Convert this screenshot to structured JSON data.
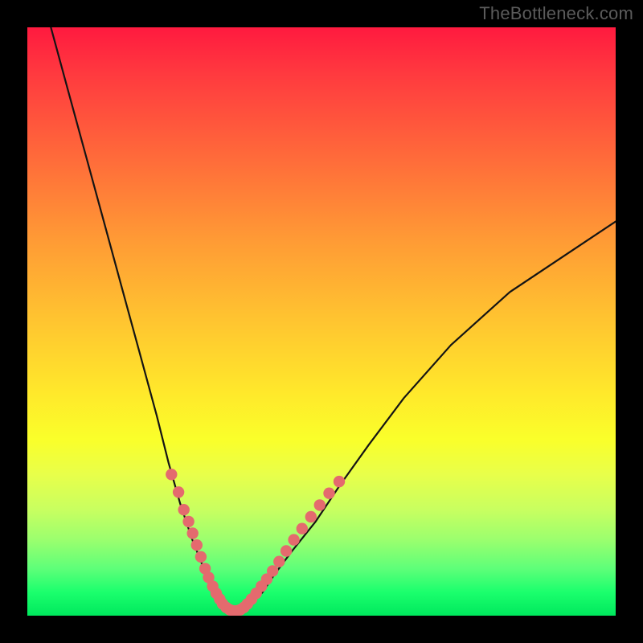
{
  "branding": {
    "watermark": "TheBottleneck.com"
  },
  "chart_data": {
    "type": "line",
    "title": "",
    "xlabel": "",
    "ylabel": "",
    "xlim": [
      0,
      100
    ],
    "ylim": [
      0,
      100
    ],
    "grid": false,
    "legend": false,
    "series": [
      {
        "name": "bottleneck-curve",
        "x": [
          4,
          7,
          10,
          13,
          16,
          19,
          22,
          24,
          26,
          28,
          30,
          31,
          32,
          33,
          34,
          35,
          36,
          38,
          40,
          42,
          45,
          49,
          53,
          58,
          64,
          72,
          82,
          94,
          100
        ],
        "y": [
          100,
          89,
          78,
          67,
          56,
          45,
          34,
          26,
          19,
          13,
          8,
          6,
          4,
          2,
          1,
          1,
          1,
          2,
          4,
          7,
          11,
          16,
          22,
          29,
          37,
          46,
          55,
          63,
          67
        ]
      }
    ],
    "marker_clusters": [
      {
        "name": "left-markers",
        "points": [
          {
            "x": 24.5,
            "y": 24
          },
          {
            "x": 25.7,
            "y": 21
          },
          {
            "x": 26.6,
            "y": 18
          },
          {
            "x": 27.4,
            "y": 16
          },
          {
            "x": 28.1,
            "y": 14
          },
          {
            "x": 28.8,
            "y": 12
          },
          {
            "x": 29.5,
            "y": 10
          },
          {
            "x": 30.2,
            "y": 8
          },
          {
            "x": 30.8,
            "y": 6.5
          },
          {
            "x": 31.5,
            "y": 5
          },
          {
            "x": 32.1,
            "y": 3.8
          },
          {
            "x": 32.7,
            "y": 2.8
          }
        ]
      },
      {
        "name": "bottom-markers",
        "points": [
          {
            "x": 33.2,
            "y": 2.0
          },
          {
            "x": 33.8,
            "y": 1.4
          },
          {
            "x": 34.4,
            "y": 1.0
          },
          {
            "x": 35.0,
            "y": 0.8
          },
          {
            "x": 35.6,
            "y": 0.8
          },
          {
            "x": 36.2,
            "y": 1.0
          },
          {
            "x": 36.8,
            "y": 1.4
          },
          {
            "x": 37.4,
            "y": 2.0
          }
        ]
      },
      {
        "name": "right-markers",
        "points": [
          {
            "x": 38.1,
            "y": 2.8
          },
          {
            "x": 38.9,
            "y": 3.8
          },
          {
            "x": 39.8,
            "y": 5.0
          },
          {
            "x": 40.7,
            "y": 6.2
          },
          {
            "x": 41.7,
            "y": 7.6
          },
          {
            "x": 42.8,
            "y": 9.2
          },
          {
            "x": 44.0,
            "y": 11.0
          },
          {
            "x": 45.3,
            "y": 12.9
          },
          {
            "x": 46.7,
            "y": 14.8
          },
          {
            "x": 48.2,
            "y": 16.8
          },
          {
            "x": 49.7,
            "y": 18.8
          },
          {
            "x": 51.3,
            "y": 20.8
          },
          {
            "x": 53.0,
            "y": 22.8
          }
        ]
      }
    ],
    "colors": {
      "curve": "#141414",
      "markers": "#e46a6e",
      "gradient_top": "#ff1a3f",
      "gradient_mid": "#ffe82b",
      "gradient_bottom": "#00e85d",
      "frame": "#000000"
    }
  }
}
